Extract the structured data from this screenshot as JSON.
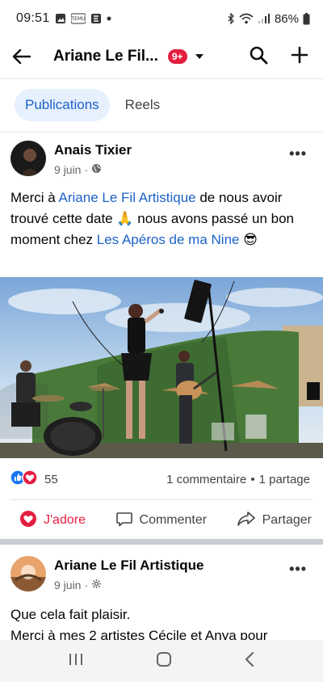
{
  "status_bar": {
    "time": "09:51",
    "battery": "86%",
    "icons_left": [
      "gallery-icon",
      "tiktok-icon",
      "calendar-icon",
      "dot-icon"
    ],
    "icons_right": [
      "bluetooth-icon",
      "wifi-icon",
      "signal-icon",
      "battery-icon"
    ]
  },
  "top_bar": {
    "title": "Ariane Le Fil...",
    "badge": "9+"
  },
  "tabs": [
    {
      "label": "Publications",
      "active": true
    },
    {
      "label": "Reels",
      "active": false
    }
  ],
  "post1": {
    "author": "Anais Tixier",
    "date": "9 juin",
    "dot": "·",
    "text_parts": {
      "p1": "Merci à ",
      "link1": "Ariane Le Fil Artistique",
      "p2": " de nous avoir trouvé cette date 🙏 nous avons passé un bon moment chez ",
      "link2": "Les Apéros de ma Nine",
      "p3": " 😎"
    },
    "reaction_count": "55",
    "comments": "1 commentaire",
    "sep": "•",
    "shares": "1 partage",
    "actions": {
      "love": "J'adore",
      "comment": "Commenter",
      "share": "Partager"
    }
  },
  "post2": {
    "author": "Ariane Le Fil Artistique",
    "date": "9 juin",
    "dot": "·",
    "line1": "Que cela fait plaisir.",
    "line2": "Merci à mes 2 artistes Cécile et Anya pour"
  },
  "colors": {
    "link": "#1c62c8",
    "badge": "#e41e3f",
    "love": "#e41e3f",
    "like": "#1877f2",
    "tab_active_bg": "#e7f0fd"
  }
}
